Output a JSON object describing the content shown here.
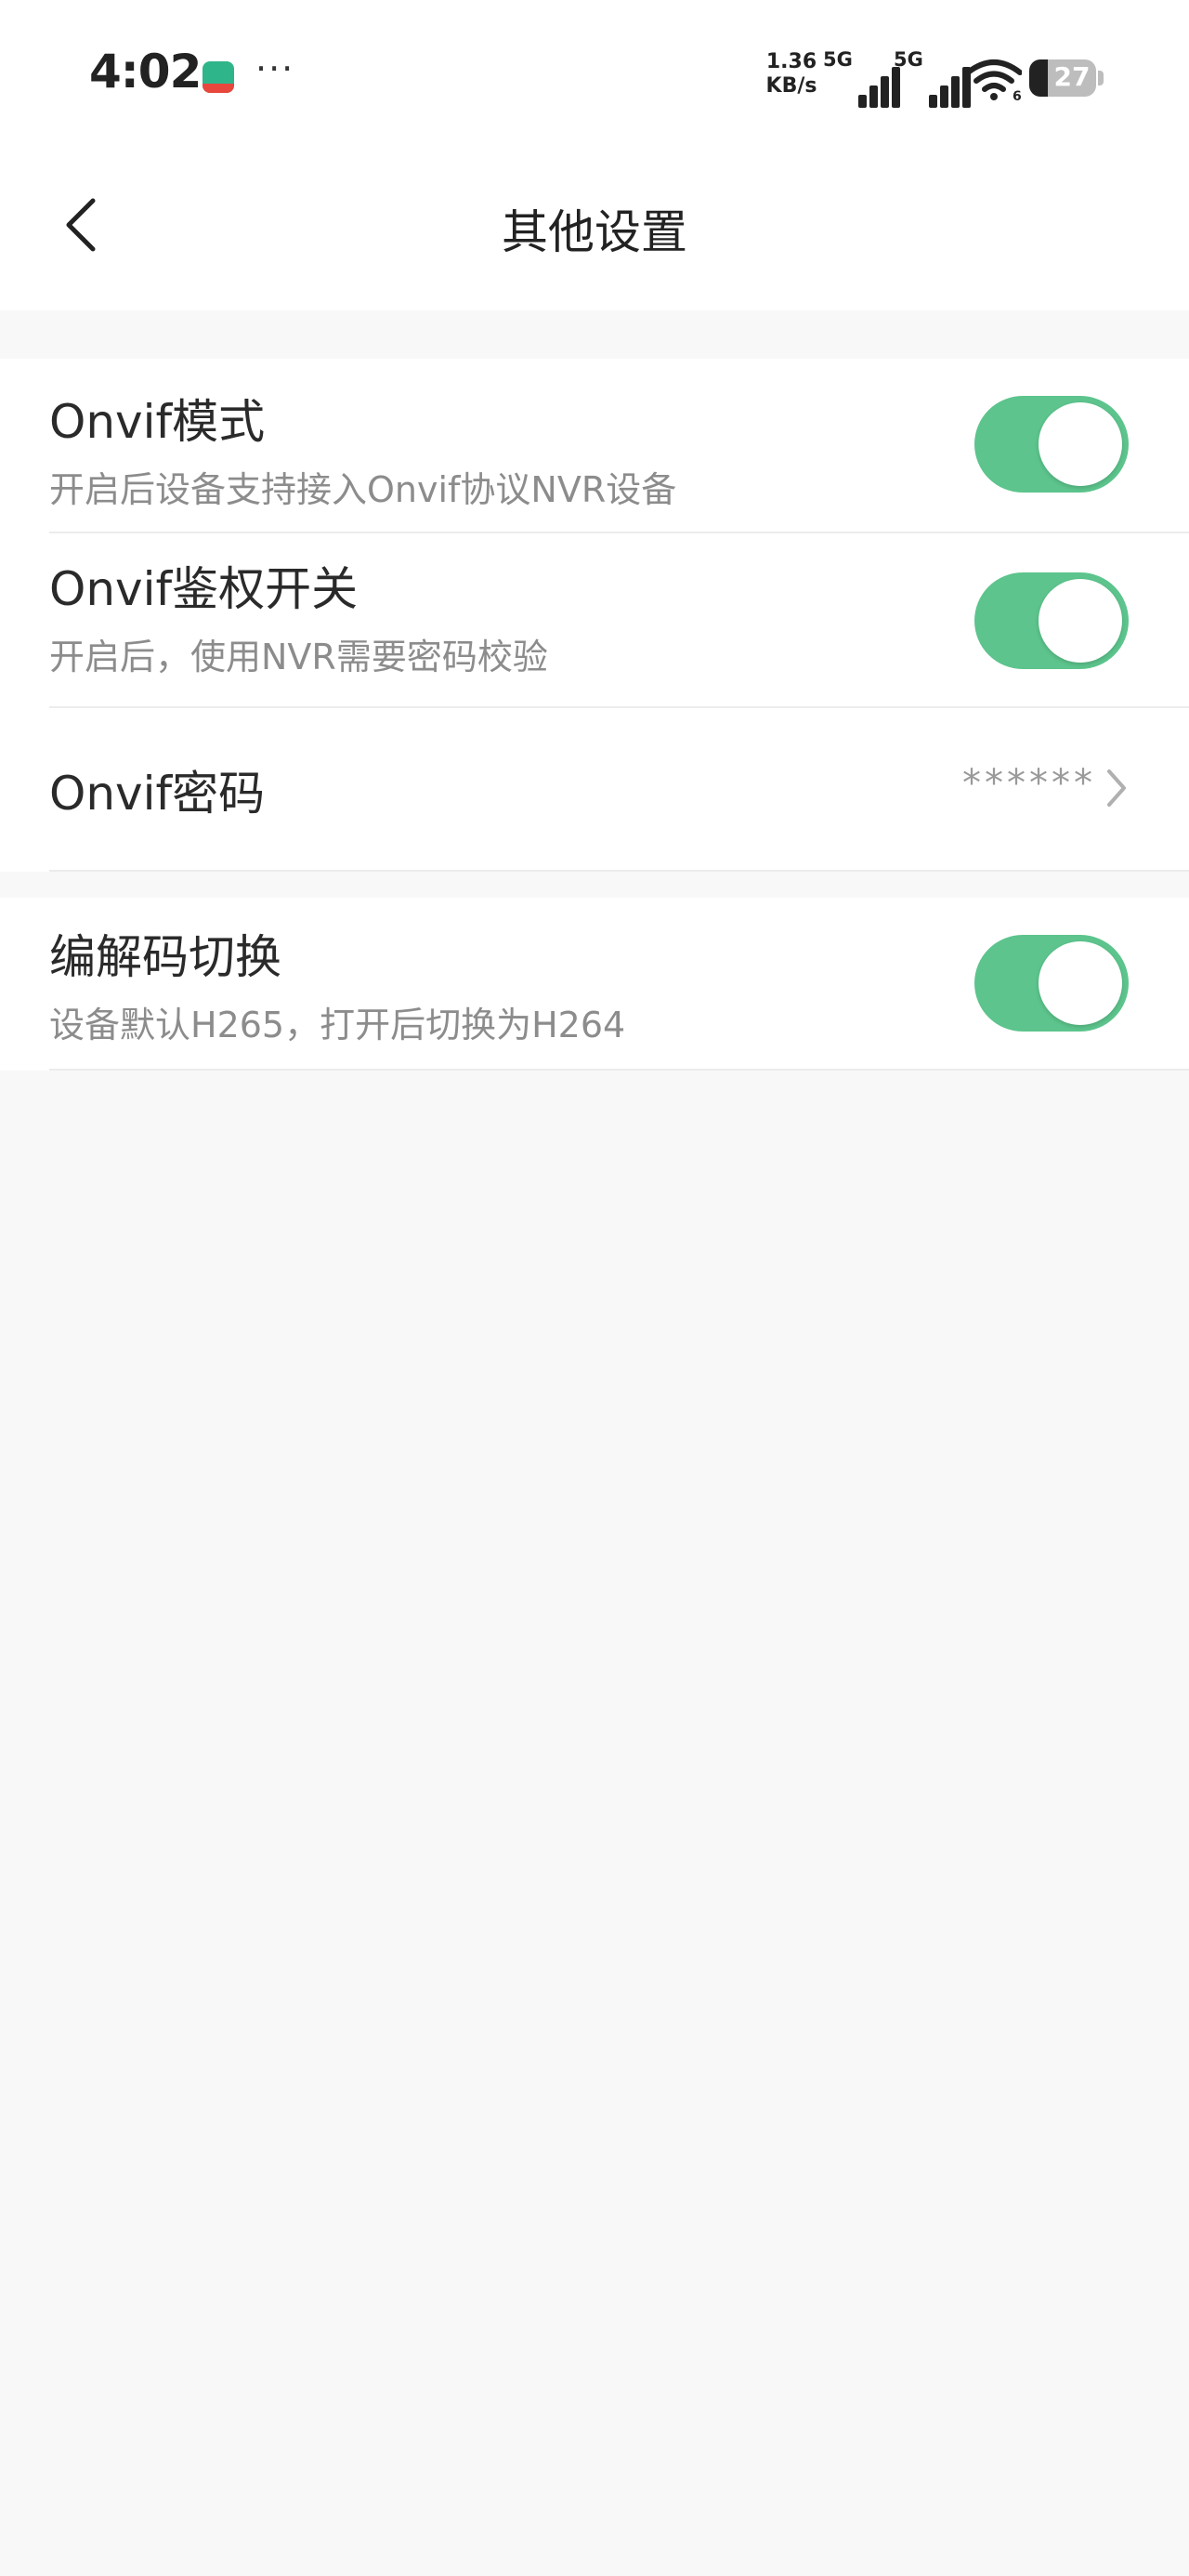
{
  "status_bar": {
    "time": "4:02",
    "more": "···",
    "net_speed_value": "1.36",
    "net_speed_unit": "KB/s",
    "signal1_label": "5G",
    "signal2_label": "5G",
    "wifi_sub": "6",
    "battery": "27"
  },
  "header": {
    "title": "其他设置"
  },
  "settings": {
    "onvif_mode": {
      "title": "Onvif模式",
      "subtitle": "开启后设备支持接入Onvif协议NVR设备",
      "enabled": true
    },
    "onvif_auth": {
      "title": "Onvif鉴权开关",
      "subtitle": "开启后，使用NVR需要密码校验",
      "enabled": true
    },
    "onvif_password": {
      "title": "Onvif密码",
      "value": "******"
    },
    "codec_switch": {
      "title": "编解码切换",
      "subtitle": "设备默认H265，打开后切换为H264",
      "enabled": true
    }
  },
  "colors": {
    "toggle_on": "#5cc48c",
    "background": "#f8f8f8",
    "card": "#ffffff"
  }
}
